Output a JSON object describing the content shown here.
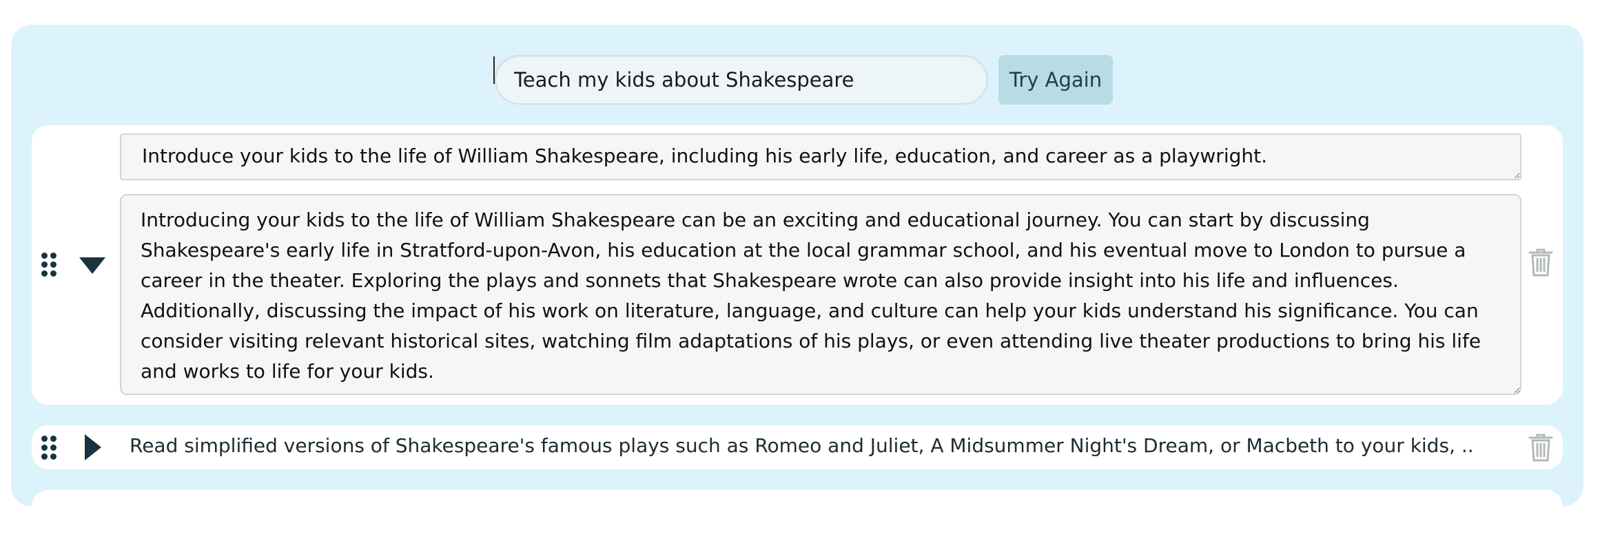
{
  "query": {
    "value": "Teach my kids about Shakespeare",
    "retry_label": "Try Again"
  },
  "cards": [
    {
      "state": "expanded",
      "title": "Introduce your kids to the life of William Shakespeare, including his early life, education, and career as a playwright.",
      "body": "Introducing your kids to the life of William Shakespeare can be an exciting and educational journey. You can start by discussing Shakespeare's early life in Stratford-upon-Avon, his education at the local grammar school, and his eventual move to London to pursue a career in the theater. Exploring the plays and sonnets that Shakespeare wrote can also provide insight into his life and influences. Additionally, discussing the impact of his work on literature, language, and culture can help your kids understand his significance. You can consider visiting relevant historical sites, watching film adaptations of his plays, or even attending live theater productions to bring his life and works to life for your kids."
    },
    {
      "state": "collapsed",
      "title": "Read simplified versions of Shakespeare's famous plays such as Romeo and Juliet, A Midsummer Night's Dream, or Macbeth to your kids, ..."
    }
  ],
  "icons": {
    "drag": "drag-handle-icon",
    "expand_down": "caret-down-icon",
    "expand_right": "caret-right-icon",
    "delete": "trash-icon"
  },
  "colors": {
    "panel_bg": "#ddf3fb",
    "button_bg": "#b9dbe5",
    "icon_dark": "#17343f"
  }
}
